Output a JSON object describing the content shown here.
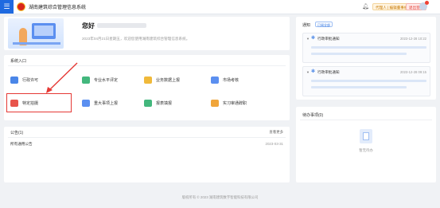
{
  "topbar": {
    "menu_icon": "hamburger-icon",
    "title": "湖南建筑综合管理信息系统",
    "bell_icon": "bell-icon",
    "badge_left": "代理人 | 编辑董事机构列表",
    "badge_right": "退出登录"
  },
  "welcome": {
    "greeting": "您好",
    "subtitle": "2023年04月21日星期五，欢迎您使用湖南建筑综合管理信息系统。"
  },
  "entry": {
    "title": "系统入口",
    "items": [
      {
        "label": "行政许可",
        "color": "#4a86e8"
      },
      {
        "label": "专业水平评定",
        "color": "#43b77d"
      },
      {
        "label": "业务数据上报",
        "color": "#f0b93a"
      },
      {
        "label": "市场考核",
        "color": "#5b8ff0"
      },
      {
        "label": "特定拍摄",
        "color": "#e8544b"
      },
      {
        "label": "重大事项上报",
        "color": "#5b8ff0"
      },
      {
        "label": "报表填报",
        "color": "#43b77d"
      },
      {
        "label": "实习审通辞职",
        "color": "#f0a53a"
      }
    ]
  },
  "notice": {
    "title": "公告",
    "count": "(1)",
    "more": "查看更多",
    "rows": [
      {
        "title": "所有通用公告",
        "date": "2023-03-31"
      }
    ]
  },
  "remind": {
    "title": "通知",
    "tag": "已阅全部",
    "items": [
      {
        "title": "行政审批通知",
        "time": "2023-12-28 10:22"
      },
      {
        "title": "行政审批通知",
        "time": "2023-12-28 09:15"
      }
    ]
  },
  "todo": {
    "title": "待办事项",
    "count": "(0)",
    "empty": "暂无待办"
  },
  "footer": {
    "text": "版权所有 © 2023 湖南建筑数字智能科技有限公司"
  }
}
